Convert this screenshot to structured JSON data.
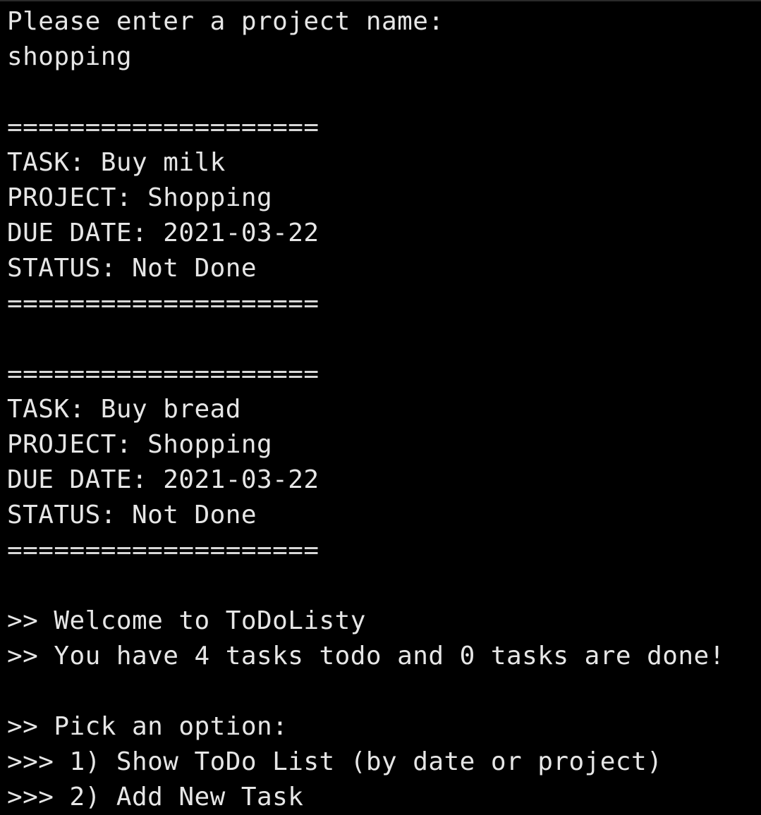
{
  "terminal": {
    "lines": [
      "Please enter a project name:",
      "shopping",
      "",
      "====================",
      "TASK: Buy milk",
      "PROJECT: Shopping",
      "DUE DATE: 2021-03-22",
      "STATUS: Not Done",
      "====================",
      "",
      "====================",
      "TASK: Buy bread",
      "PROJECT: Shopping",
      "DUE DATE: 2021-03-22",
      "STATUS: Not Done",
      "====================",
      "",
      ">> Welcome to ToDoListy",
      ">> You have 4 tasks todo and 0 tasks are done!",
      "",
      ">> Pick an option:",
      ">>> 1) Show ToDo List (by date or project)",
      ">>> 2) Add New Task"
    ]
  },
  "colors": {
    "background": "#000000",
    "foreground": "#e6e6e6"
  }
}
